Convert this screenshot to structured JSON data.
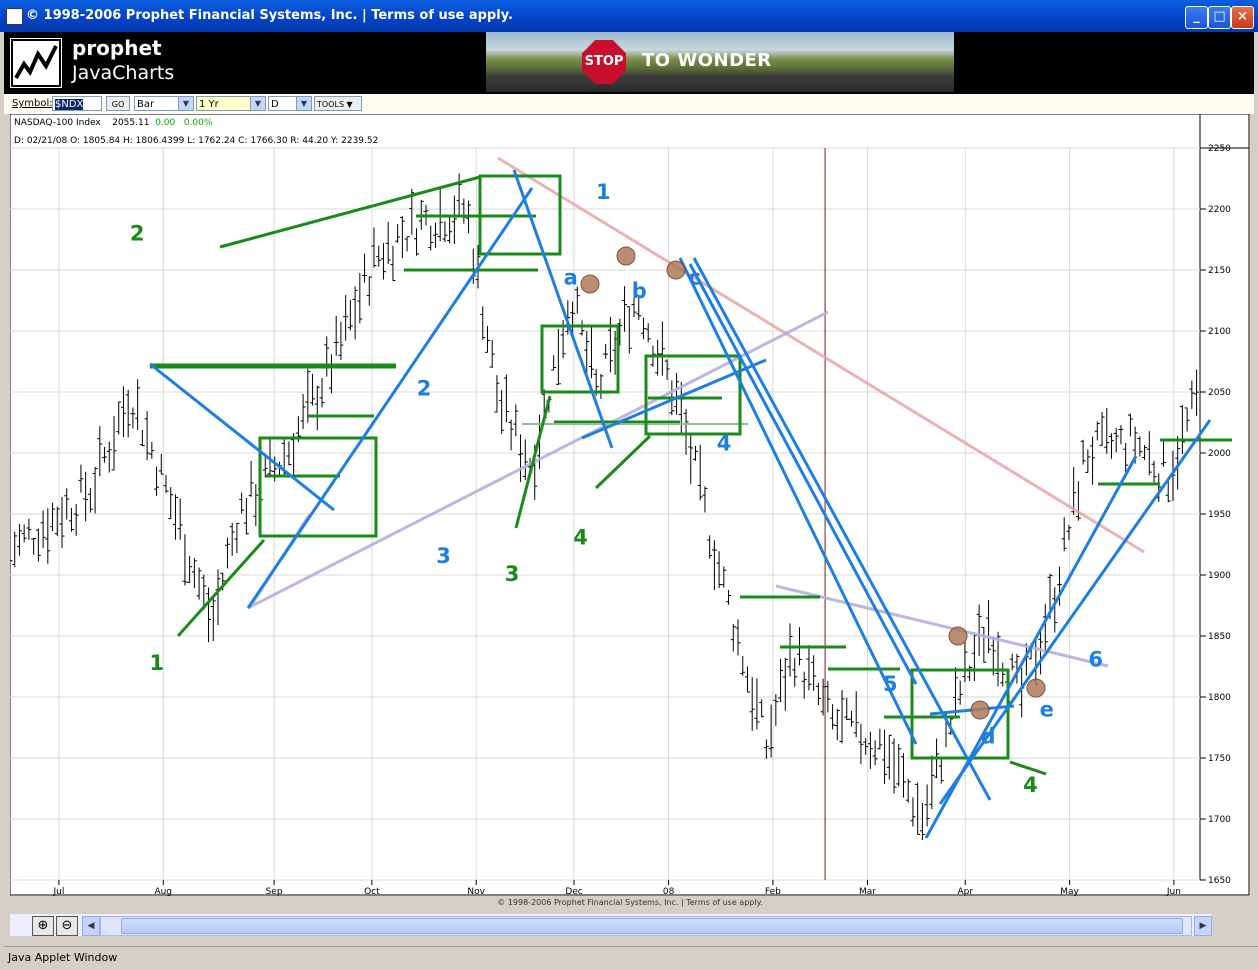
{
  "window": {
    "title": "© 1998-2006 Prophet Financial Systems, Inc.  |  Terms of use apply.",
    "minimize": "_",
    "maximize": "□",
    "close": "×"
  },
  "header": {
    "brand": "prophet",
    "product": "JavaCharts",
    "banner_sign": "STOP",
    "banner_text": "TO WONDER"
  },
  "toolbar": {
    "symbol_label": "Symbol:",
    "symbol_value": "$NDX",
    "go_label": "GO",
    "chart_type": "Bar",
    "period": "1 Yr",
    "interval": "D",
    "tools_label": "TOOLS"
  },
  "info": {
    "name": "NASDAQ-100 Index",
    "last": "2055.11",
    "change": "0.00",
    "change_pct": "0.00%",
    "ohlc": "D: 02/21/08  O: 1805.84  H: 1806.4399  L: 1762.24  C: 1766.30  R: 44.20  Y: 2239.52"
  },
  "footer": {
    "copyright": "© 1998-2006 Prophet Financial Systems, Inc. | Terms of use apply."
  },
  "status_bar": "Java Applet Window",
  "colors": {
    "green": "#1a8a1a",
    "blue": "#1f7fe0",
    "red_trend": "#e8a0a0",
    "purple_trend": "#b3b0e0",
    "bars": "#000000",
    "cursor": "#8b1a1a"
  },
  "chart_data": {
    "type": "bar",
    "title": "",
    "ylim": [
      1650,
      2250
    ],
    "yticks": [
      1650,
      1700,
      1750,
      1800,
      1850,
      1900,
      1950,
      2000,
      2050,
      2100,
      2150,
      2200,
      2250
    ],
    "xticks": [
      "Jul",
      "Aug",
      "Sep",
      "Oct",
      "Nov",
      "Dec",
      "08",
      "Feb",
      "Mar",
      "Apr",
      "May",
      "Jun"
    ],
    "xtick_day": [
      15,
      47,
      81,
      111,
      143,
      173,
      202,
      234,
      263,
      293,
      325,
      357
    ],
    "x_days_total": 365,
    "cursor_day": 250,
    "anchors": [
      [
        0,
        1920
      ],
      [
        10,
        1940
      ],
      [
        25,
        1970
      ],
      [
        37,
        2050
      ],
      [
        52,
        1940
      ],
      [
        62,
        1860
      ],
      [
        70,
        1950
      ],
      [
        85,
        2000
      ],
      [
        100,
        2080
      ],
      [
        112,
        2160
      ],
      [
        125,
        2190
      ],
      [
        140,
        2200
      ],
      [
        150,
        2040
      ],
      [
        160,
        1990
      ],
      [
        172,
        2130
      ],
      [
        180,
        2050
      ],
      [
        192,
        2130
      ],
      [
        205,
        2040
      ],
      [
        218,
        1900
      ],
      [
        232,
        1760
      ],
      [
        240,
        1840
      ],
      [
        252,
        1780
      ],
      [
        268,
        1760
      ],
      [
        280,
        1700
      ],
      [
        292,
        1810
      ],
      [
        300,
        1860
      ],
      [
        310,
        1800
      ],
      [
        320,
        1880
      ],
      [
        330,
        2000
      ],
      [
        345,
        2010
      ],
      [
        355,
        1980
      ],
      [
        365,
        2050
      ]
    ],
    "wave_labels_green": [
      {
        "text": "1",
        "day": 45,
        "y": 1822
      },
      {
        "text": "2",
        "day": 39,
        "y": 2174
      },
      {
        "text": "3",
        "day": 154,
        "y": 1895
      },
      {
        "text": "4",
        "day": 175,
        "y": 1925
      },
      {
        "text": "4",
        "day": 313,
        "y": 1722
      }
    ],
    "wave_labels_blue": [
      {
        "text": "1",
        "day": 182,
        "y": 2208
      },
      {
        "text": "2",
        "day": 127,
        "y": 2047
      },
      {
        "text": "3",
        "day": 133,
        "y": 1910
      },
      {
        "text": "4",
        "day": 219,
        "y": 2002
      },
      {
        "text": "5",
        "day": 270,
        "y": 1805
      },
      {
        "text": "6",
        "day": 333,
        "y": 1825
      },
      {
        "text": "a",
        "day": 172,
        "y": 2138
      },
      {
        "text": "b",
        "day": 193,
        "y": 2127
      },
      {
        "text": "c",
        "day": 210,
        "y": 2138
      },
      {
        "text": "d",
        "day": 300,
        "y": 1762
      },
      {
        "text": "e",
        "day": 318,
        "y": 1784
      }
    ]
  }
}
